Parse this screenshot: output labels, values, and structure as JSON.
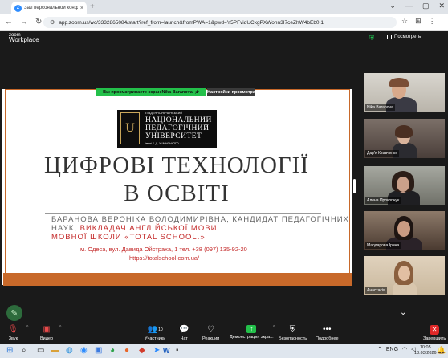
{
  "browser": {
    "tab_title": "Зал персональной конф...",
    "tab_close": "×",
    "new_tab": "+",
    "window_controls": [
      "⌄",
      "—",
      "▢",
      "✕"
    ],
    "nav_icons": [
      "←",
      "→",
      "↻"
    ],
    "url": "app.zoom.us/wc/3332865084/start?ref_from=launch&fromPWA=1&pwd=Y5PFviqUCkgPXWonn3I7ceZhW4bEb0.1",
    "toolbar_icons": [
      "☆",
      "⊞",
      "⋮"
    ]
  },
  "zoom": {
    "logo_line1": "zoom",
    "logo_line2": "Workplace",
    "view_label": "Посмотреть",
    "share_banner": "Вы просматриваете экран  Nika Baranova",
    "share_settings": "Настройки просмотра",
    "slide": {
      "uni_small": "ПІВДЕННОУКРАЇНСЬКИЙ",
      "uni_name_1": "НАЦІОНАЛЬНИЙ",
      "uni_name_2": "ПЕДАГОГІЧНИЙ",
      "uni_name_3": "УНІВЕРСИТЕТ",
      "uni_sub": "імені К. Д. УШИНСЬКОГО",
      "emblem": "U",
      "title_line1": "ЦИФРОВІ ТЕХНОЛОГІЇ",
      "title_line2": "В ОСВІТІ",
      "author_name": "БАРАНОВА ВЕРОНІКА ВОЛОДИМИРІВНА,",
      "author_role1": " КАНДИДАТ ПЕДАГОГІЧНИХ",
      "author_role2a": "НАУК,",
      "author_role2b": " ВИКЛАДАЧ АНГЛІЙСЬКОЇ МОВИ",
      "author_school": "МОВНОЇ ШКОЛИ «TOTAL SCHOOL.»",
      "address": "м. Одеса, вул. Давида Ойстраха, 1     тел. +38 (097) 135-92-20",
      "website": "https://totalschool.com.ua/"
    },
    "participants": [
      {
        "name": "Nika Baranova"
      },
      {
        "name": "Дар'я Кравченко"
      },
      {
        "name": "Алена Прокопчук"
      },
      {
        "name": "Мардарова Ірина"
      },
      {
        "name": "Анастасія"
      }
    ],
    "more_participants": "⌄",
    "toolbar": {
      "audio": "Звук",
      "video": "Видео",
      "participants": "Участники",
      "participants_count": "10",
      "chat": "Чат",
      "reactions": "Реакции",
      "share": "Демонстрация экра...",
      "security": "Безопасность",
      "more": "Подробнее",
      "end": "Завершить"
    }
  },
  "taskbar": {
    "lang": "ENG",
    "time": "10:05",
    "date": "18.03.2026"
  },
  "colors": {
    "accent_green": "#23c04a",
    "end_red": "#e02828",
    "slide_orange": "#c8692a",
    "slide_red_text": "#c42b2b"
  }
}
